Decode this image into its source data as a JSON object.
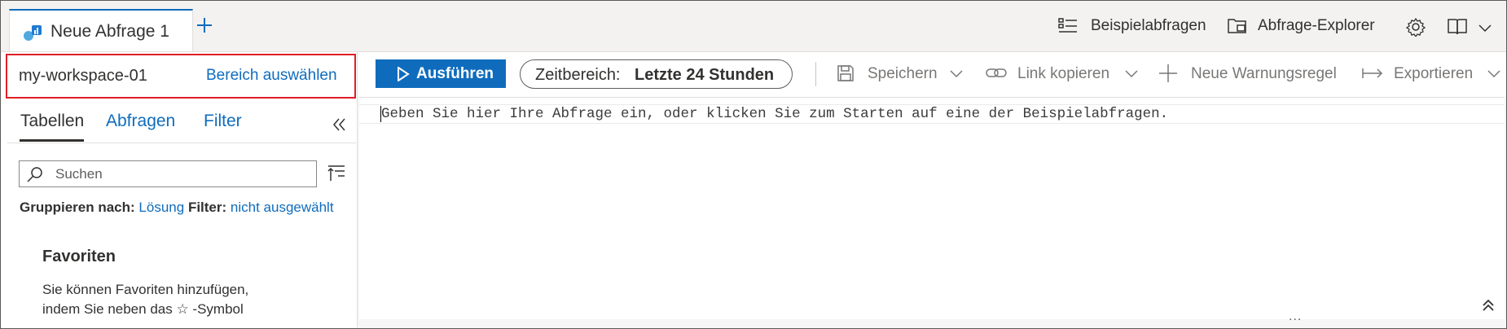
{
  "tab": {
    "title": "Neue Abfrage 1",
    "add_label": "+"
  },
  "header": {
    "sample_queries": "Beispielabfragen",
    "query_explorer": "Abfrage-Explorer",
    "icons": [
      "list-icon",
      "folder-explorer-icon",
      "settings-gear-icon",
      "book-icon"
    ]
  },
  "workspace": {
    "name": "my-workspace-01",
    "select_scope": "Bereich auswählen"
  },
  "left_tabs": [
    {
      "label": "Tabellen",
      "active": true
    },
    {
      "label": "Abfragen",
      "active": false
    },
    {
      "label": "Filter",
      "active": false
    }
  ],
  "search": {
    "placeholder": "Suchen",
    "value": ""
  },
  "grouping": {
    "group_label": "Gruppieren nach:",
    "group_value": "Lösung",
    "filter_label": "Filter:",
    "filter_value": "nicht ausgewählt"
  },
  "favorites": {
    "title": "Favoriten",
    "line1": "Sie können Favoriten hinzufügen,",
    "line2": "indem Sie neben das ☆ -Symbol"
  },
  "toolbar": {
    "run": "Ausführen",
    "time_range_label": "Zeitbereich:",
    "time_range_value": "Letzte 24 Stunden",
    "save": "Speichern",
    "copy_link": "Link kopieren",
    "new_alert": "Neue Warnungsregel",
    "export": "Exportieren"
  },
  "editor": {
    "placeholder": "Geben Sie hier Ihre Abfrage ein, oder klicken Sie zum Starten auf eine der Beispielabfragen.",
    "resize_handle": "..."
  },
  "colors": {
    "accent": "#0f6cbd",
    "highlight_border": "#e01f26"
  }
}
